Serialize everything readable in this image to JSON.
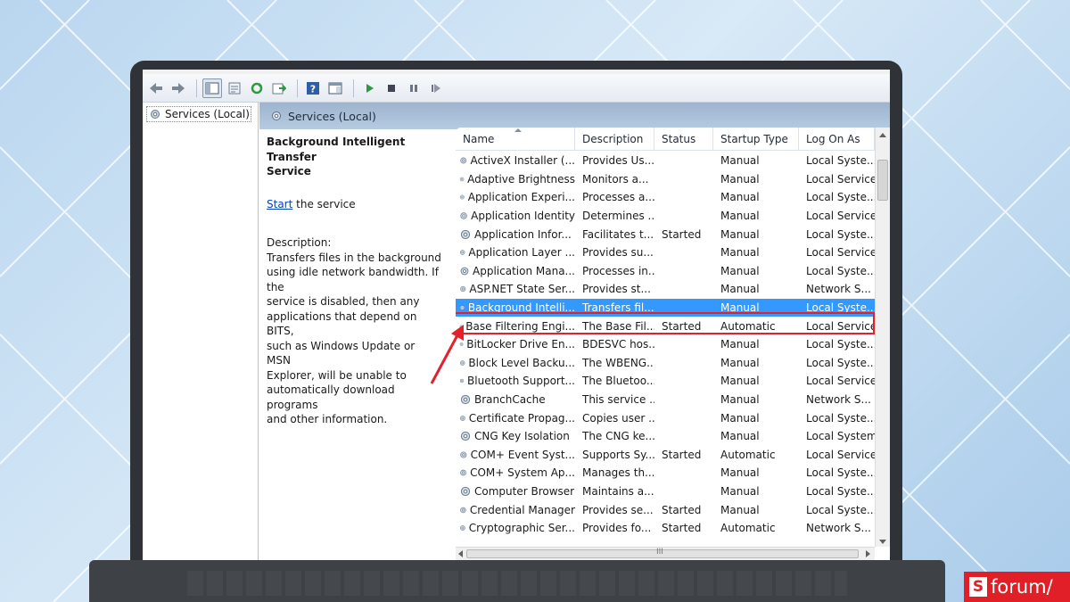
{
  "window": {
    "tree_item": "Services (Local)",
    "header_title": "Services (Local)"
  },
  "description_pane": {
    "service_title_line1": "Background Intelligent Transfer",
    "service_title_line2": "Service",
    "start_link": "Start",
    "start_suffix": " the service",
    "description_label": "Description:",
    "description_lines": [
      "Transfers files in the background",
      "using idle network bandwidth. If the",
      "service is disabled, then any",
      "applications that depend on BITS,",
      "such as Windows Update or MSN",
      "Explorer, will be unable to",
      "automatically download programs",
      "and other information."
    ]
  },
  "table": {
    "columns": [
      "Name",
      "Description",
      "Status",
      "Startup Type",
      "Log On As"
    ],
    "rows": [
      {
        "name": "ActiveX Installer (...",
        "description": "Provides Us...",
        "status": "",
        "startup": "Manual",
        "logon": "Local Syste..."
      },
      {
        "name": "Adaptive Brightness",
        "description": "Monitors a...",
        "status": "",
        "startup": "Manual",
        "logon": "Local Service"
      },
      {
        "name": "Application Experi...",
        "description": "Processes a...",
        "status": "",
        "startup": "Manual",
        "logon": "Local Syste..."
      },
      {
        "name": "Application Identity",
        "description": "Determines ...",
        "status": "",
        "startup": "Manual",
        "logon": "Local Service"
      },
      {
        "name": "Application Infor...",
        "description": "Facilitates t...",
        "status": "Started",
        "startup": "Manual",
        "logon": "Local Syste..."
      },
      {
        "name": "Application Layer ...",
        "description": "Provides su...",
        "status": "",
        "startup": "Manual",
        "logon": "Local Service"
      },
      {
        "name": "Application Mana...",
        "description": "Processes in...",
        "status": "",
        "startup": "Manual",
        "logon": "Local Syste..."
      },
      {
        "name": "ASP.NET State Ser...",
        "description": "Provides st...",
        "status": "",
        "startup": "Manual",
        "logon": "Network S..."
      },
      {
        "name": "Background Intelli...",
        "description": "Transfers fil...",
        "status": "",
        "startup": "Manual",
        "logon": "Local Syste..."
      },
      {
        "name": "Base Filtering Engi...",
        "description": "The Base Fil...",
        "status": "Started",
        "startup": "Automatic",
        "logon": "Local Service"
      },
      {
        "name": "BitLocker Drive En...",
        "description": "BDESVC hos...",
        "status": "",
        "startup": "Manual",
        "logon": "Local Syste..."
      },
      {
        "name": "Block Level Backu...",
        "description": "The WBENG...",
        "status": "",
        "startup": "Manual",
        "logon": "Local Syste..."
      },
      {
        "name": "Bluetooth Support...",
        "description": "The Bluetoo...",
        "status": "",
        "startup": "Manual",
        "logon": "Local Service"
      },
      {
        "name": "BranchCache",
        "description": "This service ...",
        "status": "",
        "startup": "Manual",
        "logon": "Network S..."
      },
      {
        "name": "Certificate Propag...",
        "description": "Copies user ...",
        "status": "",
        "startup": "Manual",
        "logon": "Local Syste..."
      },
      {
        "name": "CNG Key Isolation",
        "description": "The CNG ke...",
        "status": "",
        "startup": "Manual",
        "logon": "Local System"
      },
      {
        "name": "COM+ Event Syst...",
        "description": "Supports Sy...",
        "status": "Started",
        "startup": "Automatic",
        "logon": "Local Service"
      },
      {
        "name": "COM+ System Ap...",
        "description": "Manages th...",
        "status": "",
        "startup": "Manual",
        "logon": "Local Syste..."
      },
      {
        "name": "Computer Browser",
        "description": "Maintains a...",
        "status": "",
        "startup": "Manual",
        "logon": "Local Syste..."
      },
      {
        "name": "Credential Manager",
        "description": "Provides se...",
        "status": "Started",
        "startup": "Manual",
        "logon": "Local Syste..."
      },
      {
        "name": "Cryptographic Ser...",
        "description": "Provides fo...",
        "status": "Started",
        "startup": "Automatic",
        "logon": "Network S..."
      }
    ],
    "selected_row": "Background Intelli...",
    "hscroll_grip": "III"
  },
  "logo": {
    "mark": "S",
    "text": "forum/"
  },
  "colors": {
    "selection": "#3399ff",
    "highlight": "#e3202b",
    "header": "#9cb4cf",
    "logo": "#e01f26"
  },
  "icons": [
    "back-icon",
    "forward-icon",
    "console-icon",
    "properties-icon",
    "refresh-icon",
    "export-icon",
    "help-icon",
    "view-icon",
    "play-icon",
    "stop-icon",
    "pause-icon",
    "restart-icon",
    "gear-icon"
  ]
}
